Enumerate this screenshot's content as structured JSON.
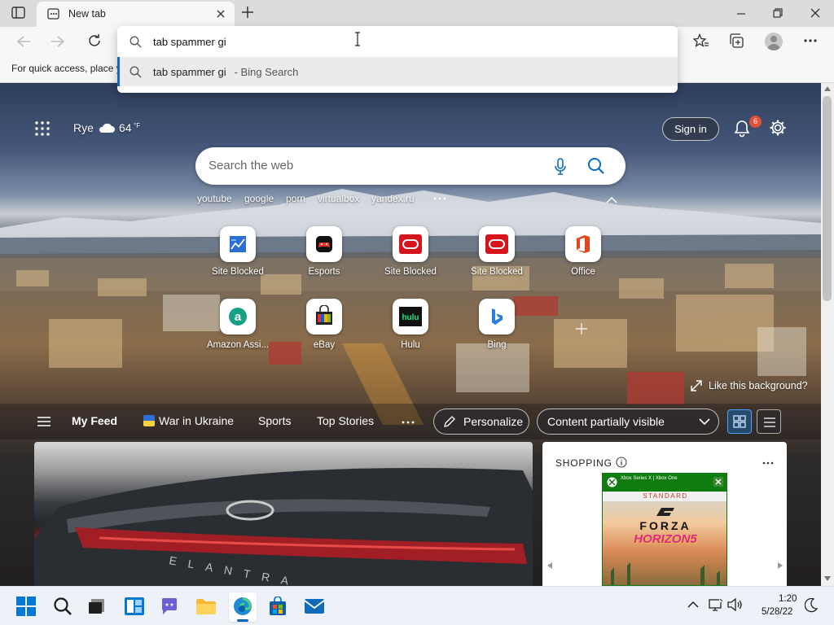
{
  "browser": {
    "tab_title": "New tab",
    "favorites_bar_text": "For quick access, place y",
    "colors": {
      "accent": "#0f6cbd",
      "tabstrip": "#dcdcdc",
      "toolbar": "#f7f7f7"
    }
  },
  "omnibox": {
    "value": "tab spammer gi",
    "suggestion_query": "tab spammer gi",
    "suggestion_source": " - Bing Search"
  },
  "ntp": {
    "location": "Rye",
    "temperature": "64",
    "temp_unit": "°F",
    "sign_in_label": "Sign in",
    "notification_count": "6",
    "search_placeholder": "Search the web",
    "quick_links": [
      "youtube",
      "google",
      "porn",
      "virtualbox",
      "yandex.ru"
    ],
    "tiles": [
      {
        "label": "Site Blocked",
        "icon": "site-blocked-chart-icon"
      },
      {
        "label": "Esports",
        "icon": "gamepad-icon"
      },
      {
        "label": "Site Blocked",
        "icon": "oracle-icon"
      },
      {
        "label": "Site Blocked",
        "icon": "oracle-icon"
      },
      {
        "label": "Office",
        "icon": "office-icon"
      },
      {
        "label": "Amazon Assi...",
        "icon": "amazon-assistant-icon"
      },
      {
        "label": "eBay",
        "icon": "ebay-icon"
      },
      {
        "label": "Hulu",
        "icon": "hulu-icon"
      },
      {
        "label": "Bing",
        "icon": "bing-icon"
      }
    ],
    "like_background": "Like this background?"
  },
  "feed": {
    "tabs": [
      "My Feed",
      "War in Ukraine",
      "Sports",
      "Top Stories"
    ],
    "personalize_label": "Personalize",
    "content_visibility": "Content partially visible",
    "shopping_header": "SHOPPING",
    "product": {
      "banner": "STANDARD",
      "top_text": "Xbox Series X | Xbox One",
      "title_line1": "FORZA",
      "title_line2": "HORIZON5"
    }
  },
  "taskbar": {
    "time": "1:20",
    "date": "5/28/22"
  }
}
